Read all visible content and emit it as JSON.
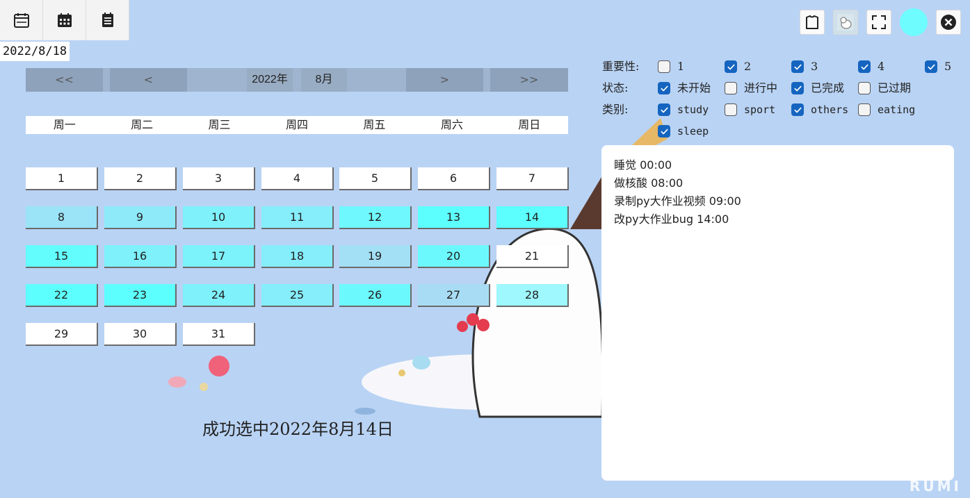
{
  "toolbar": {
    "views": [
      {
        "icon": "calendar-week-icon"
      },
      {
        "icon": "calendar-month-icon"
      },
      {
        "icon": "list-icon"
      }
    ],
    "current_date": "2022/8/18"
  },
  "top_right": {
    "icons": [
      "skin-icon",
      "avatar-image-icon",
      "fullscreen-icon",
      "theme-color-icon",
      "close-icon"
    ],
    "theme_color": "#6ffcff"
  },
  "nav": {
    "prev_year": "<<",
    "prev_month": "<",
    "year": "2022年",
    "month": "8月",
    "next_month": ">",
    "next_year": ">>"
  },
  "weekdays": [
    "周一",
    "周二",
    "周三",
    "周四",
    "周五",
    "周六",
    "周日"
  ],
  "days": [
    {
      "n": "1",
      "color": "#ffffff"
    },
    {
      "n": "2",
      "color": "#ffffff"
    },
    {
      "n": "3",
      "color": "#ffffff"
    },
    {
      "n": "4",
      "color": "#ffffff"
    },
    {
      "n": "5",
      "color": "#ffffff"
    },
    {
      "n": "6",
      "color": "#ffffff"
    },
    {
      "n": "7",
      "color": "#ffffff"
    },
    {
      "n": "8",
      "color": "#9be3f7"
    },
    {
      "n": "9",
      "color": "#8eeaf9"
    },
    {
      "n": "10",
      "color": "#7ef1fb"
    },
    {
      "n": "11",
      "color": "#86eefb"
    },
    {
      "n": "12",
      "color": "#6ff8fd"
    },
    {
      "n": "13",
      "color": "#5dfffe"
    },
    {
      "n": "14",
      "color": "#5cfffe"
    },
    {
      "n": "15",
      "color": "#63fdfd"
    },
    {
      "n": "16",
      "color": "#7ef1fb"
    },
    {
      "n": "17",
      "color": "#7cf2fb"
    },
    {
      "n": "18",
      "color": "#86eefb"
    },
    {
      "n": "19",
      "color": "#a3dff5"
    },
    {
      "n": "20",
      "color": "#6cf9fd"
    },
    {
      "n": "21",
      "color": "#ffffff"
    },
    {
      "n": "22",
      "color": "#5dfffe"
    },
    {
      "n": "23",
      "color": "#5dfffe"
    },
    {
      "n": "24",
      "color": "#7ef1fb"
    },
    {
      "n": "25",
      "color": "#86eefb"
    },
    {
      "n": "26",
      "color": "#6cf9fd"
    },
    {
      "n": "27",
      "color": "#a8dcf4"
    },
    {
      "n": "28",
      "color": "#9ef8fd"
    },
    {
      "n": "29",
      "color": "#ffffff"
    },
    {
      "n": "30",
      "color": "#ffffff"
    },
    {
      "n": "31",
      "color": "#ffffff"
    }
  ],
  "status_message": "成功选中2022年8月14日",
  "filters": {
    "importance": {
      "label": "重要性:",
      "options": [
        {
          "text": "1",
          "checked": false
        },
        {
          "text": "2",
          "checked": true
        },
        {
          "text": "3",
          "checked": true
        },
        {
          "text": "4",
          "checked": true
        },
        {
          "text": "5",
          "checked": true
        }
      ]
    },
    "status": {
      "label": "状态:",
      "options": [
        {
          "text": "未开始",
          "checked": true
        },
        {
          "text": "进行中",
          "checked": false
        },
        {
          "text": "已完成",
          "checked": true
        },
        {
          "text": "已过期",
          "checked": false
        }
      ]
    },
    "category": {
      "label": "类别:",
      "options": [
        {
          "text": "study",
          "checked": true
        },
        {
          "text": "sport",
          "checked": false
        },
        {
          "text": "others",
          "checked": true
        },
        {
          "text": "eating",
          "checked": false
        },
        {
          "text": "sleep",
          "checked": true
        }
      ]
    }
  },
  "events": [
    "睡觉 00:00",
    "做核酸 08:00",
    "录制py大作业视频 09:00",
    "改py大作业bug 14:00"
  ],
  "watermark": "RUMI"
}
